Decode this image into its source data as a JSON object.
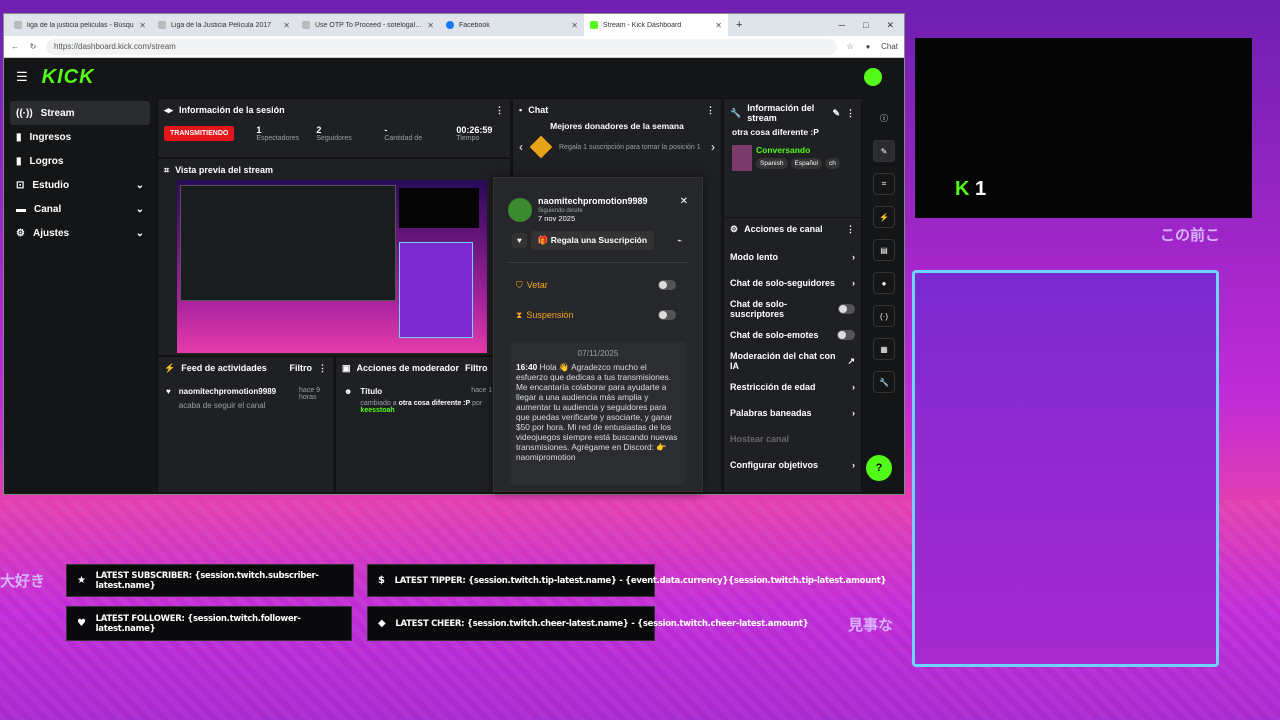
{
  "tabs": [
    {
      "title": "liga de la justicia peliculas - Búsqu"
    },
    {
      "title": "Liga de la Justicia Película 2017"
    },
    {
      "title": "Use OTP To Proceed - sotelogalvir"
    },
    {
      "title": "Facebook"
    },
    {
      "title": "Stream - Kick Dashboard"
    }
  ],
  "address": {
    "url": "https://dashboard.kick.com/stream",
    "copilot": "Chat"
  },
  "kick": {
    "logo": "KICK"
  },
  "sidebar": {
    "items": [
      {
        "label": "Stream"
      },
      {
        "label": "Ingresos"
      },
      {
        "label": "Logros"
      },
      {
        "label": "Estudio"
      },
      {
        "label": "Canal"
      },
      {
        "label": "Ajustes"
      }
    ]
  },
  "session": {
    "title": "Información de la sesión",
    "live": "TRANSMITIENDO",
    "stats": [
      {
        "value": "1",
        "label": "Espectadores"
      },
      {
        "value": "2",
        "label": "Seguidores"
      },
      {
        "value": "-",
        "label": "Cantidad de"
      },
      {
        "value": "00:26:59",
        "label": "Tiempo"
      }
    ]
  },
  "preview": {
    "title": "Vista previa del stream"
  },
  "activity": {
    "title": "Feed de actividades",
    "filter": "Filtro",
    "user": "naomitechpromotion9989",
    "action": "acaba de seguir el canal",
    "time": "hace 9 horas"
  },
  "modactions": {
    "title": "Acciones de moderador",
    "filter": "Filtro",
    "item_title": "Título",
    "time": "hace 1 ho",
    "desc": "cambiado a",
    "value": "otra cosa diferente :P",
    "by": "por",
    "user": "keesstoah"
  },
  "chat": {
    "title": "Chat",
    "donors_title": "Mejores donadores de la semana",
    "donor_text": "Regala 1 suscripción para tomar la posición 1"
  },
  "streaminfo": {
    "title": "Información del stream",
    "name": "otra cosa diferente :P",
    "category": "Conversando",
    "tags": [
      "Spanish",
      "Español",
      "ch"
    ]
  },
  "channel_actions": {
    "title": "Acciones de canal",
    "items": [
      {
        "label": "Modo lento"
      },
      {
        "label": "Chat de solo-seguidores"
      },
      {
        "label": "Chat de solo-suscriptores"
      },
      {
        "label": "Chat de solo-emotes"
      },
      {
        "label": "Moderación del chat con IA"
      },
      {
        "label": "Restricción de edad"
      },
      {
        "label": "Palabras baneadas"
      },
      {
        "label": "Hostear canal"
      },
      {
        "label": "Configurar objetivos"
      }
    ]
  },
  "popup": {
    "user": "naomitechpromotion9989",
    "following_label": "Siguiendo desde",
    "following_date": "7 nov 2025",
    "gift_button": "Regala una Suscripción",
    "ban": "Vetar",
    "timeout": "Suspensión",
    "date": "07/11/2025",
    "msg_time": "16:40",
    "message": "Hola 👋 Agradezco mucho el esfuerzo que dedicas a tus transmisiones. Me encantaría colaborar para ayudarte a llegar a una audiencia más amplia y aumentar tu audiencia y seguidores para que puedas verificarte y asociarte, y ganar $50 por hora. Mi red de entusiastas de los videojuegos siempre está buscando nuevas transmisiones. Agrégame en Discord: 👉 naomipromotion"
  },
  "overlay": {
    "subscriber": "LATEST SUBSCRIBER: {session.twitch.subscriber-latest.name}",
    "tipper": "LATEST TIPPER: {session.twitch.tip-latest.name} - {event.data.currency}{session.twitch.tip-latest.amount}",
    "follower": "LATEST FOLLOWER: {session.twitch.follower-latest.name}",
    "cheer": "LATEST CHEER: {session.twitch.cheer-latest.name} - {session.twitch.cheer-latest.amount}",
    "viewer_count": "1"
  }
}
